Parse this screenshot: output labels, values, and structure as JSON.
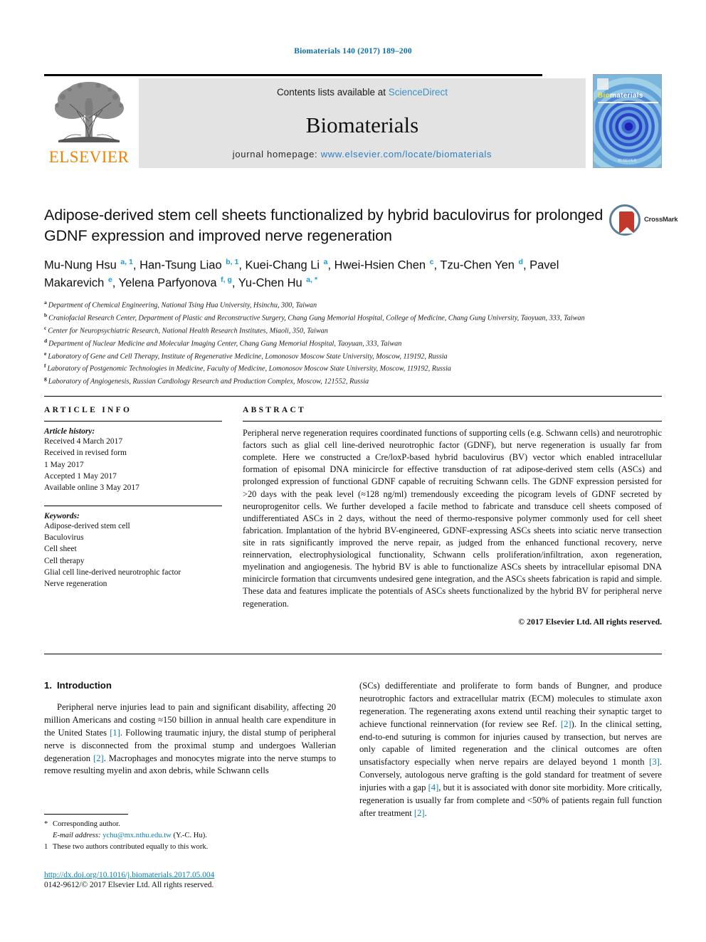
{
  "running_head": "Biomaterials 140 (2017) 189–200",
  "masthead": {
    "publisher_name": "ELSEVIER",
    "contents_prefix": "Contents lists available at ",
    "contents_link": "ScienceDirect",
    "journal_name": "Biomaterials",
    "homepage_prefix": "journal homepage: ",
    "homepage_url": "www.elsevier.com/locate/biomaterials",
    "cover": {
      "title_first": "Bio",
      "title_rest": "materials",
      "footer": "ELSEVIER"
    }
  },
  "article": {
    "title": "Adipose-derived stem cell sheets functionalized by hybrid baculovirus for prolonged GDNF expression and improved nerve regeneration",
    "crossmark_label": "CrossMark",
    "authors": [
      {
        "name": "Mu-Nung Hsu",
        "sup": "a, 1",
        "sep": ", "
      },
      {
        "name": "Han-Tsung Liao",
        "sup": "b, 1",
        "sep": ", "
      },
      {
        "name": "Kuei-Chang Li",
        "sup": "a",
        "sep": ", "
      },
      {
        "name": "Hwei-Hsien Chen",
        "sup": "c",
        "sep": ", "
      },
      {
        "name": "Tzu-Chen Yen",
        "sup": "d",
        "sep": ", "
      },
      {
        "name": "Pavel Makarevich",
        "sup": "e",
        "sep": ", "
      },
      {
        "name": "Yelena Parfyonova",
        "sup": "f, g",
        "sep": ", "
      },
      {
        "name": "Yu-Chen Hu",
        "sup": "a, *",
        "sep": ""
      }
    ],
    "affiliations": [
      {
        "marker": "a",
        "text": "Department of Chemical Engineering, National Tsing Hua University, Hsinchu, 300, Taiwan"
      },
      {
        "marker": "b",
        "text": "Craniofacial Research Center, Department of Plastic and Reconstructive Surgery, Chang Gung Memorial Hospital, College of Medicine, Chang Gung University, Taoyuan, 333, Taiwan"
      },
      {
        "marker": "c",
        "text": "Center for Neuropsychiatric Research, National Health Research Institutes, Miaoli, 350, Taiwan"
      },
      {
        "marker": "d",
        "text": "Department of Nuclear Medicine and Molecular Imaging Center, Chang Gung Memorial Hospital, Taoyuan, 333, Taiwan"
      },
      {
        "marker": "e",
        "text": "Laboratory of Gene and Cell Therapy, Institute of Regenerative Medicine, Lomonosov Moscow State University, Moscow, 119192, Russia"
      },
      {
        "marker": "f",
        "text": "Laboratory of Postgenomic Technologies in Medicine, Faculty of Medicine, Lomonosov Moscow State University, Moscow, 119192, Russia"
      },
      {
        "marker": "g",
        "text": "Laboratory of Angiogenesis, Russian Cardiology Research and Production Complex, Moscow, 121552, Russia"
      }
    ]
  },
  "article_info": {
    "heading": "ARTICLE INFO",
    "history_label": "Article history:",
    "history": [
      "Received 4 March 2017",
      "Received in revised form",
      "1 May 2017",
      "Accepted 1 May 2017",
      "Available online 3 May 2017"
    ],
    "keywords_label": "Keywords:",
    "keywords": [
      "Adipose-derived stem cell",
      "Baculovirus",
      "Cell sheet",
      "Cell therapy",
      "Glial cell line-derived neurotrophic factor",
      "Nerve regeneration"
    ]
  },
  "abstract": {
    "heading": "ABSTRACT",
    "text": "Peripheral nerve regeneration requires coordinated functions of supporting cells (e.g. Schwann cells) and neurotrophic factors such as glial cell line-derived neurotrophic factor (GDNF), but nerve regeneration is usually far from complete. Here we constructed a Cre/loxP-based hybrid baculovirus (BV) vector which enabled intracellular formation of episomal DNA minicircle for effective transduction of rat adipose-derived stem cells (ASCs) and prolonged expression of functional GDNF capable of recruiting Schwann cells. The GDNF expression persisted for >20 days with the peak level (≈128 ng/ml) tremendously exceeding the picogram levels of GDNF secreted by neuroprogenitor cells. We further developed a facile method to fabricate and transduce cell sheets composed of undifferentiated ASCs in 2 days, without the need of thermo-responsive polymer commonly used for cell sheet fabrication. Implantation of the hybrid BV-engineered, GDNF-expressing ASCs sheets into sciatic nerve transection site in rats significantly improved the nerve repair, as judged from the enhanced functional recovery, nerve reinnervation, electrophysiological functionality, Schwann cells proliferation/infiltration, axon regeneration, myelination and angiogenesis. The hybrid BV is able to functionalize ASCs sheets by intracellular episomal DNA minicircle formation that circumvents undesired gene integration, and the ASCs sheets fabrication is rapid and simple. These data and features implicate the potentials of ASCs sheets functionalized by the hybrid BV for peripheral nerve regeneration.",
    "copyright": "© 2017 Elsevier Ltd. All rights reserved."
  },
  "introduction": {
    "number": "1.",
    "heading": "Introduction",
    "left_paragraph_a": "Peripheral nerve injuries lead to pain and significant disability, affecting 20 million Americans and costing ≈150 billion in annual health care expenditure in the United States ",
    "left_ref_1": "[1]",
    "left_paragraph_b": ". Following traumatic injury, the distal stump of peripheral nerve is disconnected from the proximal stump and undergoes Wallerian degeneration ",
    "left_ref_2": "[2]",
    "left_paragraph_c": ". Macrophages and monocytes migrate into the nerve stumps to remove resulting myelin and axon debris, while Schwann cells",
    "right_paragraph_a": "(SCs) dedifferentiate and proliferate to form bands of Bungner, and produce neurotrophic factors and extracellular matrix (ECM) molecules to stimulate axon regeneration. The regenerating axons extend until reaching their synaptic target to achieve functional reinnervation (for review see Ref. ",
    "right_ref_1": "[2]",
    "right_paragraph_b": "). In the clinical setting, end-to-end suturing is common for injuries caused by transection, but nerves are only capable of limited regeneration and the clinical outcomes are often unsatisfactory especially when nerve repairs are delayed beyond 1 month ",
    "right_ref_2": "[3]",
    "right_paragraph_c": ". Conversely, autologous nerve grafting is the gold standard for treatment of severe injuries with a gap ",
    "right_ref_3": "[4]",
    "right_paragraph_d": ", but it is associated with donor site morbidity. More critically, regeneration is usually far from complete and <50% of patients regain full function after treatment ",
    "right_ref_4": "[2]",
    "right_paragraph_e": "."
  },
  "footnotes": {
    "corresponding_marker": "*",
    "corresponding_text": "Corresponding author.",
    "email_label": "E-mail address:",
    "email": "ychu@mx.nthu.edu.tw",
    "email_owner": "(Y.-C. Hu).",
    "equal_marker": "1",
    "equal_text": "These two authors contributed equally to this work."
  },
  "footer": {
    "doi": "http://dx.doi.org/10.1016/j.biomaterials.2017.05.004",
    "issn_line": "0142-9612/© 2017 Elsevier Ltd. All rights reserved."
  },
  "colors": {
    "link_blue": "#0b7fb5",
    "sciencedirect_blue": "#3b92c7",
    "elsevier_orange": "#f08000",
    "sup_blue": "#1a9ad6"
  }
}
